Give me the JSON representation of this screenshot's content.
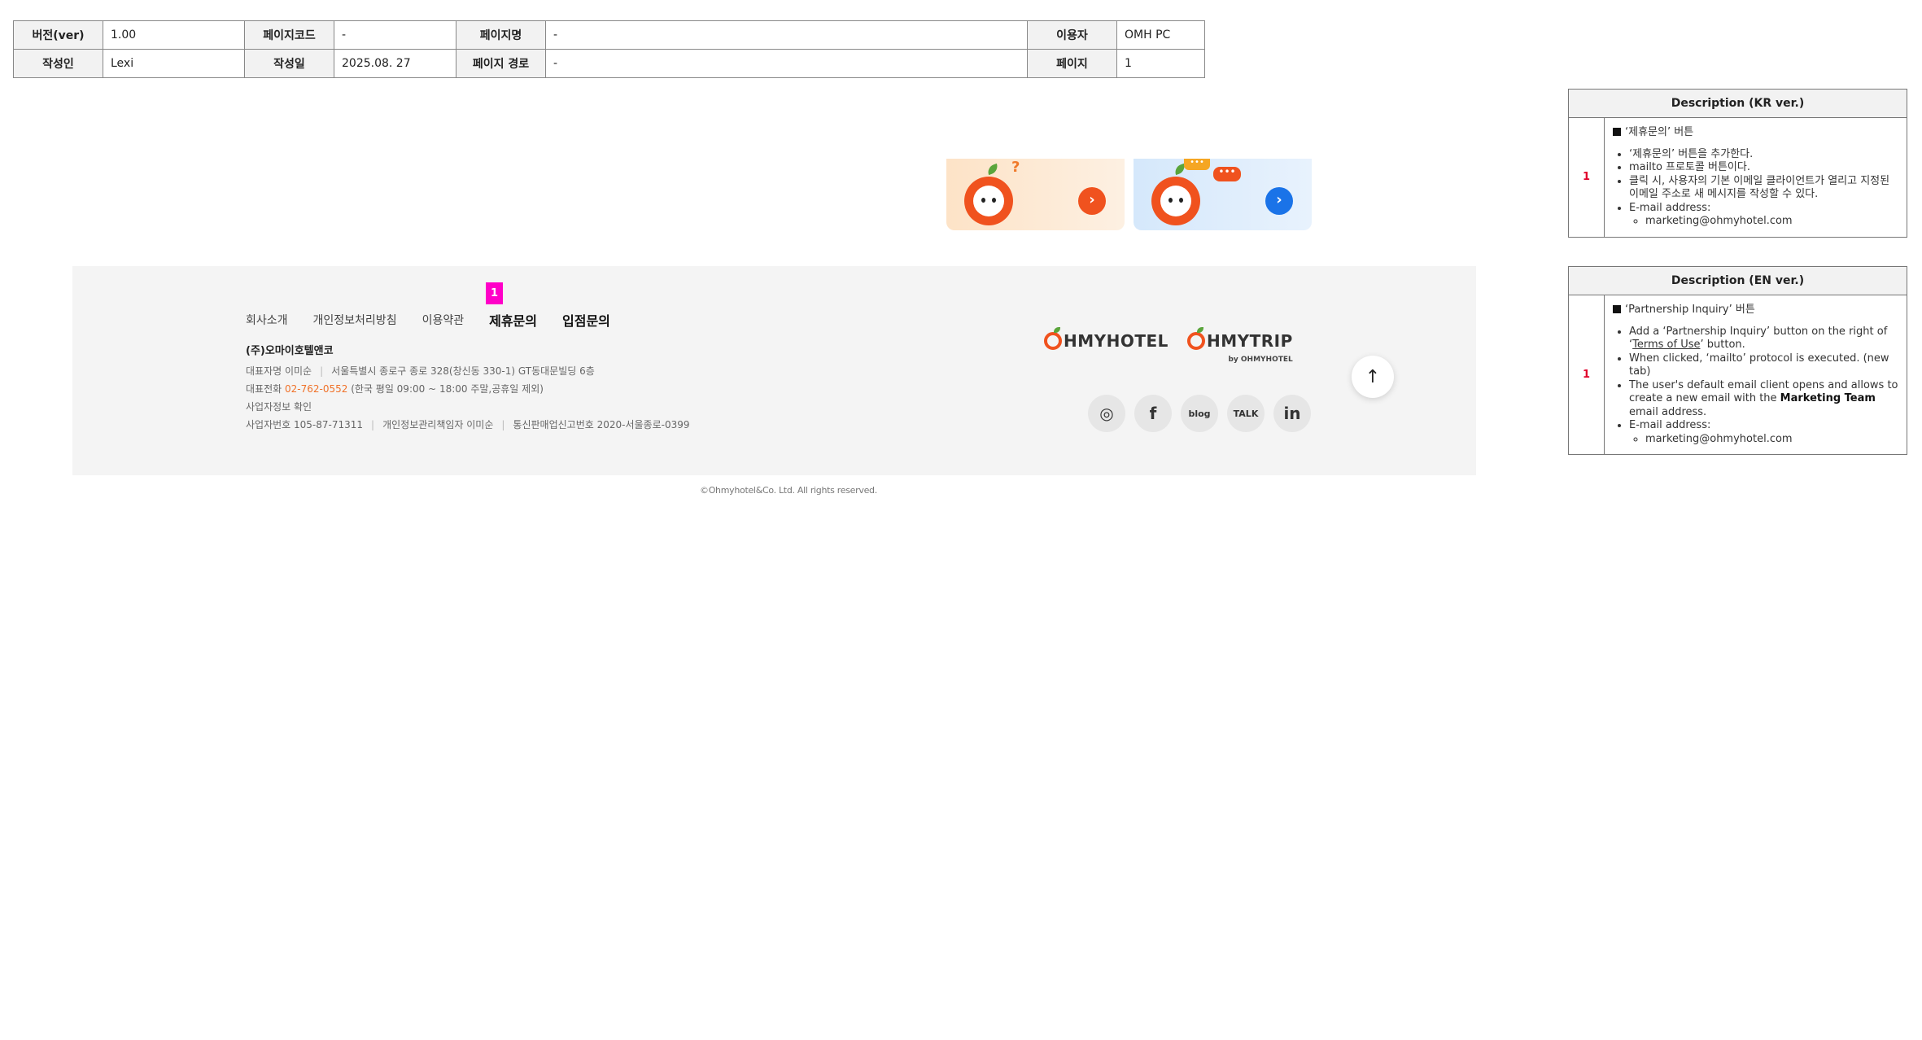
{
  "meta": {
    "ver_label": "버전(ver)",
    "ver_value": "1.00",
    "code_label": "페이지코드",
    "code_value": "-",
    "name_label": "페이지명",
    "name_value": "-",
    "user_label": "이용자",
    "user_value": "OMH PC",
    "author_label": "작성인",
    "author_value": "Lexi",
    "date_label": "작성일",
    "date_value": "2025.08. 27",
    "path_label": "페이지 경로",
    "path_value": "-",
    "page_label": "페이지",
    "page_value": "1"
  },
  "desc_kr": {
    "header": "Description (KR ver.)",
    "num": "1",
    "title": "‘제휴문의’ 버튼",
    "items": [
      "‘제휴문의’ 버튼을 추가한다.",
      "mailto 프로토콜 버튼이다.",
      "클릭 시, 사용자의 기본 이메일 클라이언트가 열리고 지정된 이메일 주소로 새 메시지를 작성할 수 있다.",
      "E-mail address:"
    ],
    "email": "marketing@ohmyhotel.com"
  },
  "desc_en": {
    "header": "Description (EN ver.)",
    "num": "1",
    "title": "‘Partnership Inquiry’ 버튼",
    "item1_a": "Add a ‘Partnership Inquiry’ button on the right of ‘",
    "item1_link": "Terms of Use",
    "item1_b": "’ button.",
    "item2": "When clicked, ‘mailto’ protocol is executed. (new tab)",
    "item3_a": "The user's default email client opens and allows to create a new email with the ",
    "item3_bold": "Marketing Team",
    "item3_b": " email address.",
    "item4": "E-mail address:",
    "email": "marketing@ohmyhotel.com"
  },
  "banners": {
    "b1_deco": "?",
    "b2_bubble1": "•••",
    "b2_bubble2": "•••",
    "arrow": "›"
  },
  "footer": {
    "badge": "1",
    "nav": [
      "회사소개",
      "개인정보처리방침",
      "이용약관",
      "제휴문의",
      "입점문의"
    ],
    "company": "(주)오마이호텔앤코",
    "ceo": "대표자명 이미순",
    "address": "서울특별시 종로구 종로 328(창신동 330-1) GT동대문빌딩 6층",
    "tel_label": "대표전화",
    "tel": "02-762-0552",
    "tel_hours": "(한국 평일 09:00 ~ 18:00 주말,공휴일 제외)",
    "biz_info": "사업자정보 확인",
    "biz_no": "사업자번호 105-87-71311",
    "privacy_officer": "개인정보관리책임자 이미순",
    "ecommerce": "통신판매업신고번호 2020-서울종로-0399",
    "logo1": "HMYHOTEL",
    "logo2": "HMYTRIP",
    "logo2_by": "by OHMYHOTEL",
    "social": [
      "instagram-icon",
      "facebook-icon",
      "blog-icon",
      "kakaotalk-icon",
      "linkedin-icon"
    ],
    "social_glyphs": [
      "◎",
      "f",
      "blog",
      "TALK",
      "in"
    ],
    "totop": "↑"
  },
  "copyright": "©Ohmyhotel&Co. Ltd. All rights reserved."
}
